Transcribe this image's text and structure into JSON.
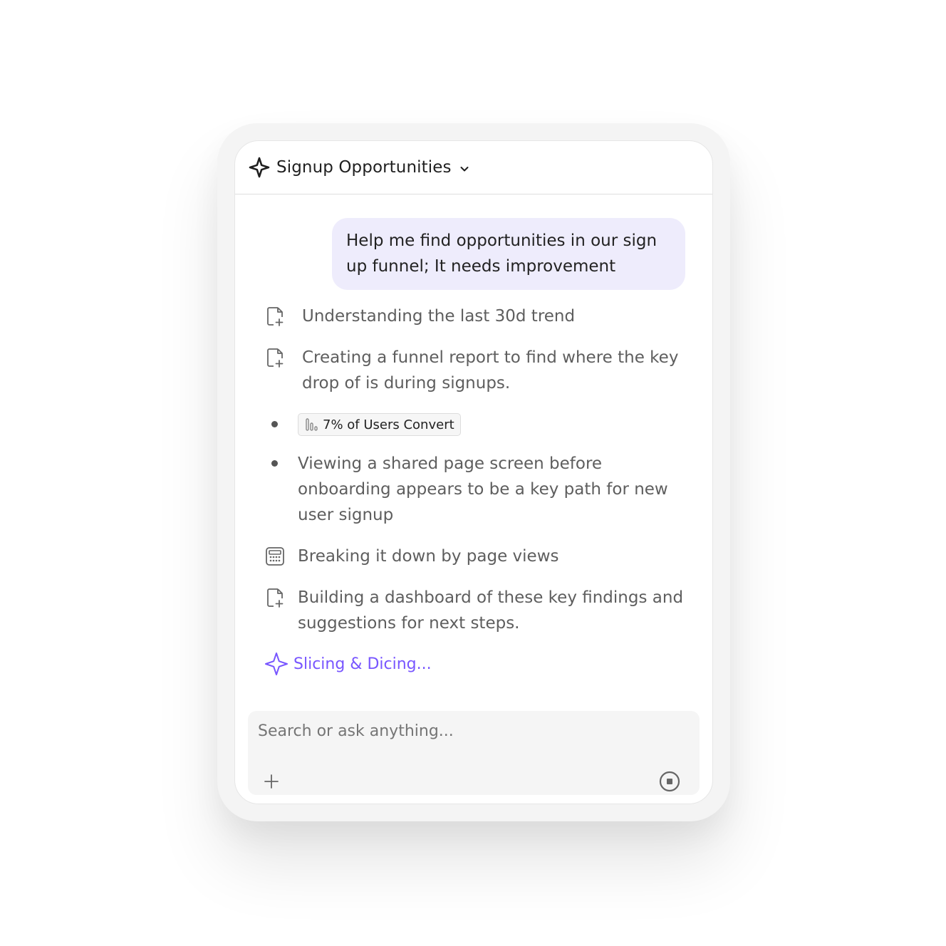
{
  "header": {
    "title": "Signup Opportunities",
    "logo_icon": "sparkle-icon",
    "dropdown_icon": "chevron-down-icon"
  },
  "conversation": {
    "user_message": "Help me find opportunities in our sign up funnel; It needs improvement",
    "steps": [
      {
        "icon": "file-plus-icon",
        "text": "Understanding the last 30d trend"
      },
      {
        "icon": "file-plus-icon",
        "text": "Creating a funnel report to find where the key drop of is during signups."
      },
      {
        "icon": "bullet",
        "chip": {
          "icon": "bar-chart-icon",
          "label": "7% of Users Convert"
        }
      },
      {
        "icon": "bullet",
        "text": "Viewing a shared page screen before onboarding appears to be a key path for new user signup"
      },
      {
        "icon": "calculator-icon",
        "text": "Breaking it down by page views"
      },
      {
        "icon": "file-plus-icon",
        "text": "Building a dashboard of these key findings and suggestions for next steps."
      }
    ],
    "status": {
      "icon": "sparkle-icon",
      "text": "Slicing & Dicing..."
    }
  },
  "composer": {
    "placeholder": "Search or ask anything...",
    "value": "",
    "add_icon": "plus-icon",
    "stop_icon": "stop-circle-icon"
  },
  "colors": {
    "accent": "#7856ff",
    "bubble": "#eeecfc",
    "frame": "#f4f4f4",
    "input_bg": "#f5f5f5"
  }
}
